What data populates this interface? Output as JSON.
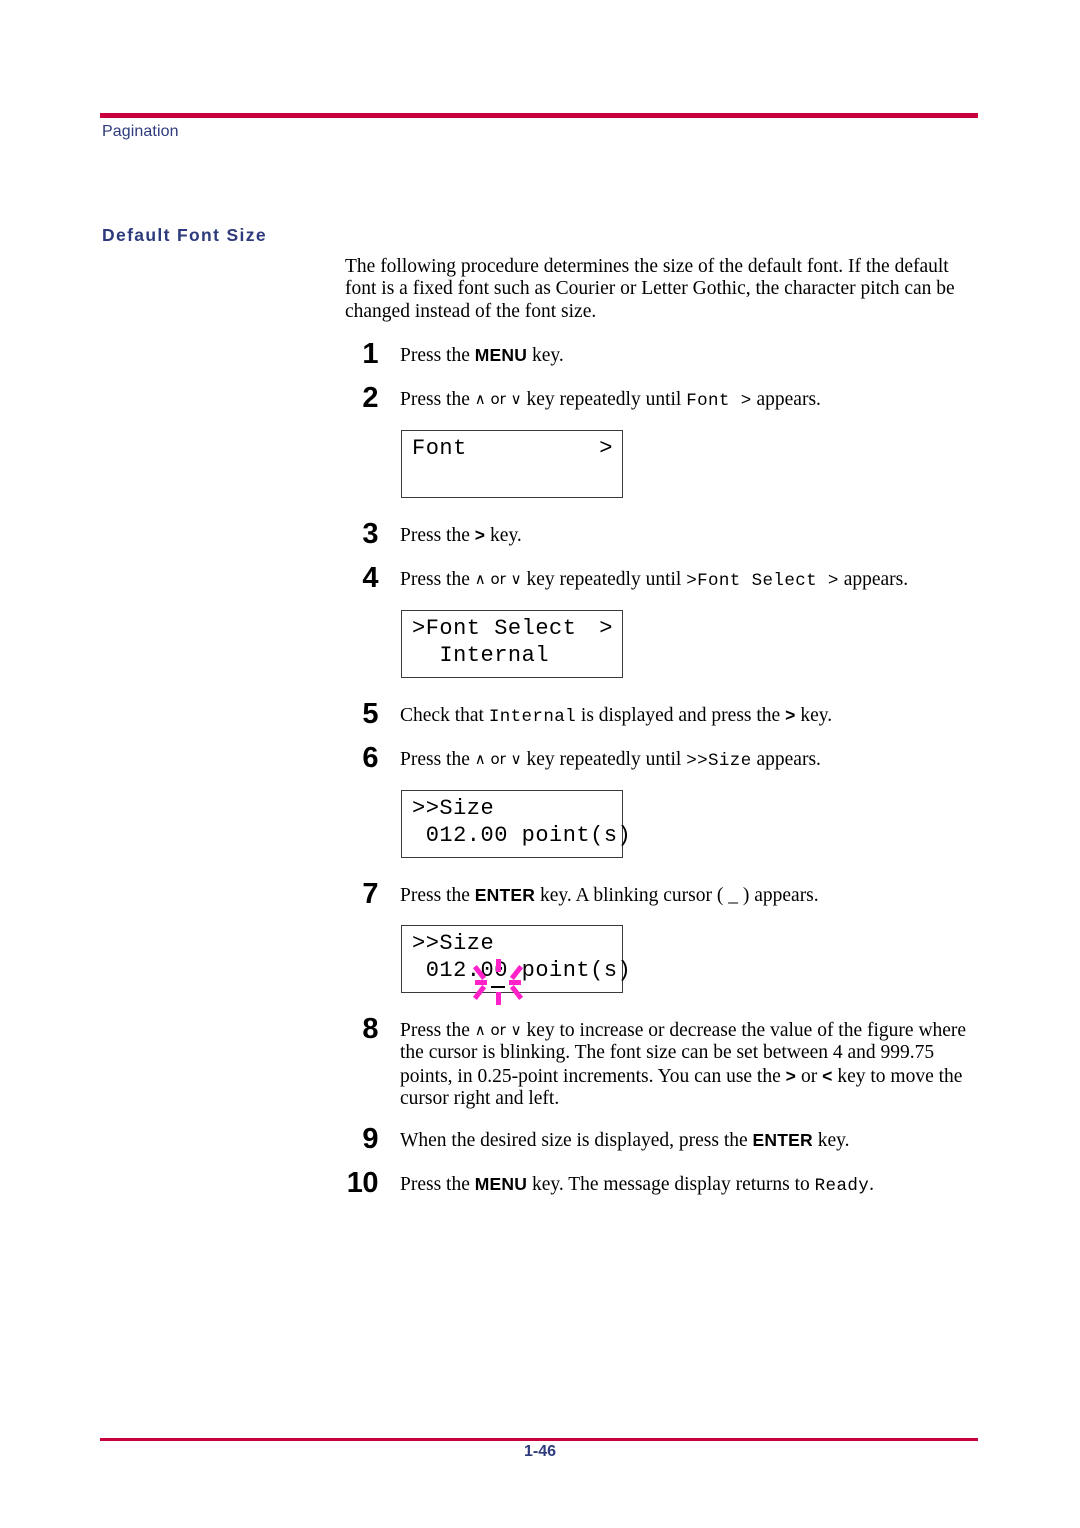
{
  "header": {
    "running_head": "Pagination",
    "rule_color": "#c8003c",
    "text_color": "#2d3a7c"
  },
  "section": {
    "heading": "Default Font Size"
  },
  "intro": "The following procedure determines the size of the default font. If the default font is a fixed font such as Courier or Letter Gothic, the character pitch can be changed instead of the font size.",
  "steps": [
    {
      "num": "1",
      "pre": "Press the ",
      "key": "MENU",
      "post": " key."
    },
    {
      "num": "2",
      "pre": "Press the ",
      "arrows": "∧ or ∨",
      "mid": " key repeatedly until ",
      "code": "Font  >",
      "post": " appears."
    },
    {
      "num": "3",
      "pre": "Press the ",
      "key": ">",
      "post": " key."
    },
    {
      "num": "4",
      "pre": "Press the ",
      "arrows": "∧ or ∨",
      "mid": " key repeatedly until ",
      "code": ">Font Select  >",
      "post": " appears."
    },
    {
      "num": "5",
      "pre": "Check that ",
      "code": "Internal",
      "mid": " is displayed and press the ",
      "key": ">",
      "post": " key."
    },
    {
      "num": "6",
      "pre": "Press the ",
      "arrows": "∧ or ∨",
      "mid": " key repeatedly until ",
      "code": ">>Size",
      "post": " appears."
    },
    {
      "num": "7",
      "pre": "Press the ",
      "key": "ENTER",
      "post": " key. A blinking cursor ( _ ) appears."
    },
    {
      "num": "8",
      "pre": "Press the ",
      "arrows": "∧ or ∨",
      "mid": " key to increase or decrease the value of the figure where the cursor is blinking. The font size can be set between 4 and 999.75 points, in 0.25-point increments. You can use the ",
      "key": ">",
      "key2": "<",
      "between_keys": " or ",
      "post": " key to move the cursor right and left."
    },
    {
      "num": "9",
      "pre": "When the desired size is displayed, press the ",
      "key": "ENTER",
      "post": " key."
    },
    {
      "num": "10",
      "pre": "Press the ",
      "key": "MENU",
      "mid2": " key. The message display returns to ",
      "code": "Ready",
      "post": "."
    }
  ],
  "lcd_panels": [
    {
      "line1_left": "Font",
      "line1_right": ">",
      "line2_left": ""
    },
    {
      "line1_left": ">Font Select",
      "line1_right": ">",
      "line2_left": "  Internal"
    },
    {
      "line1_left": ">>Size",
      "line1_right": "",
      "line2_left": " 012.00 point(s)"
    },
    {
      "line1_left": ">>Size",
      "line1_right": "",
      "line2_left": " 012.00 point(s)",
      "cursor_marker": true,
      "cursor_marker_color": "#ff22c8"
    }
  ],
  "footer": {
    "page_number": "1-46",
    "rule_color": "#c8003c",
    "text_color": "#2d3a7c"
  }
}
